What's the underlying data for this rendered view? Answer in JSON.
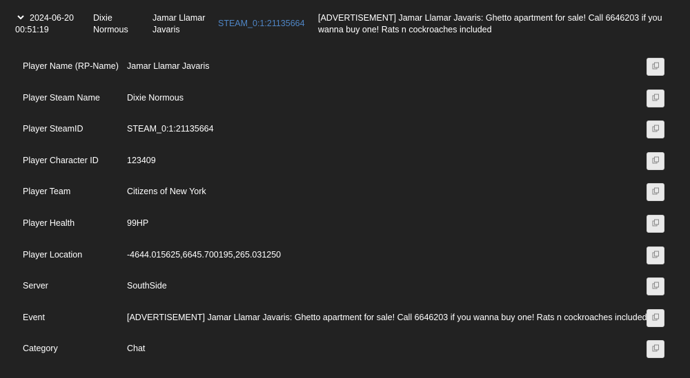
{
  "log_entry": {
    "date": "2024-06-20",
    "time": "00:51:19",
    "steam_name": "Dixie Normous",
    "rp_name": "Jamar Llamar Javaris",
    "steamid": "STEAM_0:1:21135664",
    "event": "[ADVERTISEMENT] Jamar Llamar Javaris: Ghetto apartment for sale! Call 6646203 if you wanna buy one! Rats n cockroaches included",
    "expanded": true
  },
  "details": [
    {
      "label": "Player Name (RP-Name)",
      "value": "Jamar Llamar Javaris"
    },
    {
      "label": "Player Steam Name",
      "value": "Dixie Normous"
    },
    {
      "label": "Player SteamID",
      "value": "STEAM_0:1:21135664"
    },
    {
      "label": "Player Character ID",
      "value": "123409"
    },
    {
      "label": "Player Team",
      "value": "Citizens of New York"
    },
    {
      "label": "Player Health",
      "value": "99HP"
    },
    {
      "label": "Player Location",
      "value": "-4644.015625,6645.700195,265.031250"
    },
    {
      "label": "Server",
      "value": "SouthSide"
    },
    {
      "label": "Event",
      "value": "[ADVERTISEMENT] Jamar Llamar Javaris: Ghetto apartment for sale! Call 6646203 if you wanna buy one! Rats n cockroaches included"
    },
    {
      "label": "Category",
      "value": "Chat"
    }
  ],
  "icons": {
    "toggle": "chevron-down-icon",
    "copy": "copy-icon"
  },
  "colors": {
    "background": "#222222",
    "text": "#ffffff",
    "link": "#4f86c6",
    "copy_button_bg": "#e9e9e9"
  }
}
